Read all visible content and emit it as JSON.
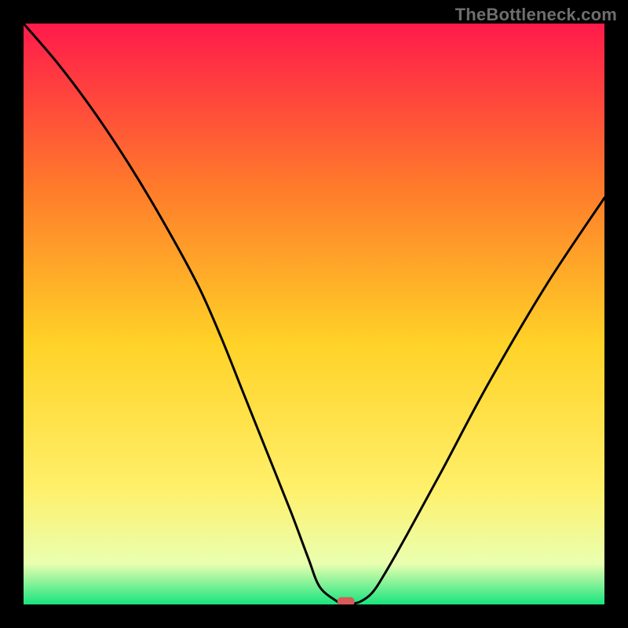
{
  "watermark": "TheBottleneck.com",
  "chart_data": {
    "type": "line",
    "title": "",
    "xlabel": "",
    "ylabel": "",
    "xlim": [
      0,
      100
    ],
    "ylim": [
      0,
      100
    ],
    "grid": false,
    "legend": false,
    "series": [
      {
        "name": "curve",
        "x": [
          0,
          6,
          12,
          18,
          24,
          30,
          34,
          38,
          42,
          46,
          49,
          51,
          54,
          55,
          56,
          58,
          60,
          62,
          66,
          72,
          80,
          90,
          100
        ],
        "y": [
          100,
          93,
          85,
          76,
          66,
          55,
          46,
          36,
          26,
          16,
          8,
          3,
          0.5,
          0,
          0,
          0.5,
          2,
          5,
          12,
          23,
          38,
          55,
          70
        ]
      }
    ],
    "marker": {
      "x": 55.5,
      "y": 0.5
    },
    "background_gradient": {
      "top": "#ff1a4b",
      "mid1": "#ff7a2b",
      "mid2": "#ffd227",
      "mid3": "#fff06a",
      "mid4": "#e9ffb0",
      "bottom": "#19e47e"
    }
  }
}
